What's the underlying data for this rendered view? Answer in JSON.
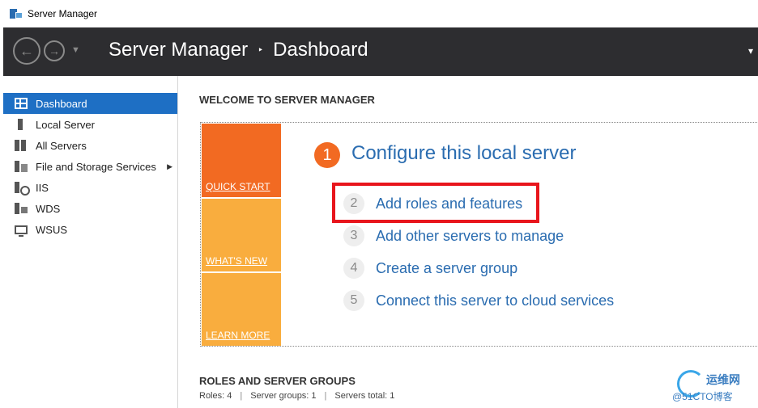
{
  "window": {
    "title": "Server Manager"
  },
  "header": {
    "breadcrumb_root": "Server Manager",
    "breadcrumb_separator": "‣",
    "breadcrumb_current": "Dashboard"
  },
  "sidebar": {
    "items": [
      {
        "label": "Dashboard",
        "icon": "dashboard-grid-icon",
        "active": true
      },
      {
        "label": "Local Server",
        "icon": "server-icon"
      },
      {
        "label": "All Servers",
        "icon": "servers-icon"
      },
      {
        "label": "File and Storage Services",
        "icon": "file-storage-icon",
        "has_submenu": true
      },
      {
        "label": "IIS",
        "icon": "iis-icon"
      },
      {
        "label": "WDS",
        "icon": "wds-icon"
      },
      {
        "label": "WSUS",
        "icon": "wsus-icon"
      }
    ]
  },
  "main": {
    "welcome_title": "WELCOME TO SERVER MANAGER",
    "tiles": {
      "quick_start": "QUICK START",
      "whats_new": "WHAT'S NEW",
      "learn_more": "LEARN MORE"
    },
    "step1": {
      "number": "1",
      "label": "Configure this local server"
    },
    "steps": [
      {
        "number": "2",
        "label": "Add roles and features"
      },
      {
        "number": "3",
        "label": "Add other servers to manage"
      },
      {
        "number": "4",
        "label": "Create a server group"
      },
      {
        "number": "5",
        "label": "Connect this server to cloud services"
      }
    ],
    "roles_title": "ROLES AND SERVER GROUPS",
    "roles_stats": {
      "roles": "Roles: 4",
      "groups": "Server groups: 1",
      "total": "Servers total: 1",
      "divider": "|"
    }
  },
  "watermark": {
    "cn": "运维网",
    "en": "@51CTO博客"
  },
  "colors": {
    "header_bg": "#2d2d30",
    "accent_blue": "#1e6fc4",
    "link_blue": "#2a6cb0",
    "orange": "#f26a22",
    "tile_yellow": "#f9ad3e",
    "highlight_red": "#e8151c"
  }
}
